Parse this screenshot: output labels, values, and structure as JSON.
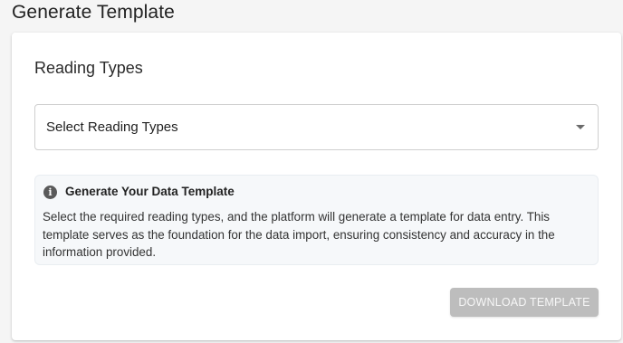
{
  "page": {
    "title": "Generate Template"
  },
  "reading_types": {
    "title": "Reading Types",
    "select_placeholder": "Select Reading Types"
  },
  "info_alert": {
    "icon": "info-icon",
    "title": "Generate Your Data Template",
    "body": "Select the required reading types, and the platform will generate a template for data entry. This template serves as the foundation for the data import, ensuring consistency and accuracy in the information provided."
  },
  "actions": {
    "download_label": "DOWNLOAD TEMPLATE",
    "download_disabled": true
  },
  "colors": {
    "page_background": "#f5f5f5",
    "card_background": "#ffffff",
    "alert_background": "#f6f8fa",
    "button_disabled": "#bdbdbd"
  }
}
